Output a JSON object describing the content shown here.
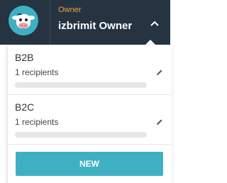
{
  "header": {
    "role": "Owner",
    "owner_name": "izbrimit Owner",
    "avatar_icon": "cow-avatar-icon",
    "toggle_icon": "chevron-up-icon"
  },
  "groups": [
    {
      "name": "B2B",
      "recipients": "1 recipients",
      "edit_icon": "pencil-icon"
    },
    {
      "name": "B2C",
      "recipients": "1 recipients",
      "edit_icon": "pencil-icon"
    }
  ],
  "actions": {
    "new_label": "NEW"
  },
  "colors": {
    "header_bg": "#263442",
    "accent": "#3fb0c4",
    "role_text": "#f0a23a"
  }
}
